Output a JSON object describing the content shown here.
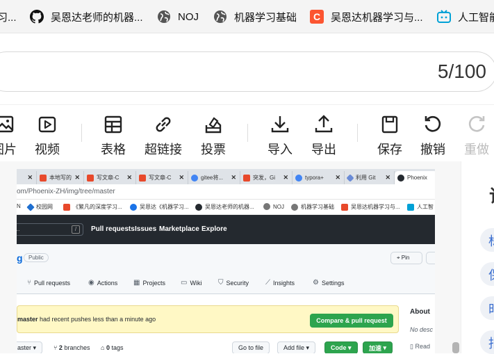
{
  "bookmarks": {
    "items": [
      {
        "label": "习...",
        "icon": "page-icon"
      },
      {
        "label": "吴恩达老师的机器...",
        "icon": "github-icon"
      },
      {
        "label": "NOJ",
        "icon": "globe-icon"
      },
      {
        "label": "机器学习基础",
        "icon": "globe-icon"
      },
      {
        "label": "吴恩达机器学习与...",
        "icon": "csdn-icon"
      },
      {
        "label": "人工智能",
        "icon": "bilibili-icon"
      }
    ]
  },
  "editor": {
    "counter": "5/100"
  },
  "toolbar": {
    "items": [
      {
        "label": "图片",
        "icon": "image-icon"
      },
      {
        "label": "视频",
        "icon": "video-icon"
      },
      {
        "label": "表格",
        "icon": "table-icon"
      },
      {
        "label": "超链接",
        "icon": "link-icon"
      },
      {
        "label": "投票",
        "icon": "vote-icon"
      },
      {
        "label": "导入",
        "icon": "download-icon"
      },
      {
        "label": "导出",
        "icon": "upload-icon"
      },
      {
        "label": "保存",
        "icon": "save-icon"
      },
      {
        "label": "撤销",
        "icon": "undo-icon"
      },
      {
        "label": "重做",
        "icon": "redo-icon",
        "disabled": true
      }
    ]
  },
  "right_panel": {
    "title": "词",
    "pills": [
      "标",
      "保",
      "时",
      "指"
    ]
  },
  "screenshot": {
    "tabs": [
      {
        "label": "",
        "color": "#c5cad0"
      },
      {
        "label": "本地写的",
        "color": "#e8492b"
      },
      {
        "label": "写文章-C",
        "color": "#e8492b"
      },
      {
        "label": "写文章-C",
        "color": "#e8492b"
      },
      {
        "label": "gitee将...",
        "color": "#4285f4"
      },
      {
        "label": "突发，Gi",
        "color": "#e8492b"
      },
      {
        "label": "typora+",
        "color": "#4285f4"
      },
      {
        "label": "利用 Git",
        "color": "#6a8bd6"
      },
      {
        "label": "Phoenix",
        "color": "#24292f",
        "active": true
      }
    ],
    "url": "om/Phoenix-ZH/img/tree/master",
    "bookmarks": [
      {
        "label": "N",
        "color": "#999999"
      },
      {
        "label": "校园网",
        "color": "#1f6fd0"
      },
      {
        "label": "《繁凡的深度学习...",
        "color": "#e8492b"
      },
      {
        "label": "吴恩达《机器学习...",
        "color": "#1a73e8"
      },
      {
        "label": "吴恩达老师的机器...",
        "color": "#24292f"
      },
      {
        "label": "NOJ",
        "color": "#777777"
      },
      {
        "label": "机器学习基础",
        "color": "#777777"
      },
      {
        "label": "吴恩达机器学习与...",
        "color": "#e8492b"
      },
      {
        "label": "人工智",
        "color": "#00a1d6"
      }
    ],
    "github": {
      "search_placeholder": "...",
      "search_key": "/",
      "nav": [
        "Pull requests",
        "Issues",
        "Marketplace",
        "Explore"
      ],
      "repo_name": "g",
      "visibility": "Public",
      "pin_label": "Pin",
      "repo_tabs": [
        {
          "label": "Pull requests",
          "icon": "pr-icon"
        },
        {
          "label": "Actions",
          "icon": "actions-icon"
        },
        {
          "label": "Projects",
          "icon": "projects-icon"
        },
        {
          "label": "Wiki",
          "icon": "wiki-icon"
        },
        {
          "label": "Security",
          "icon": "security-icon"
        },
        {
          "label": "Insights",
          "icon": "insights-icon"
        },
        {
          "label": "Settings",
          "icon": "settings-icon"
        }
      ],
      "banner_branch": "master",
      "banner_text": " had recent pushes less than a minute ago",
      "compare_button": "Compare & pull request",
      "about_title": "About",
      "about_desc": "No desc",
      "branch_select": "aster",
      "branches_count": "2",
      "branches_label": "branches",
      "tags_count": "0",
      "tags_label": "tags",
      "goto_file": "Go to file",
      "add_file": "Add file",
      "code_button": "Code",
      "jiashu_button": "加速",
      "readme": "Read"
    }
  }
}
